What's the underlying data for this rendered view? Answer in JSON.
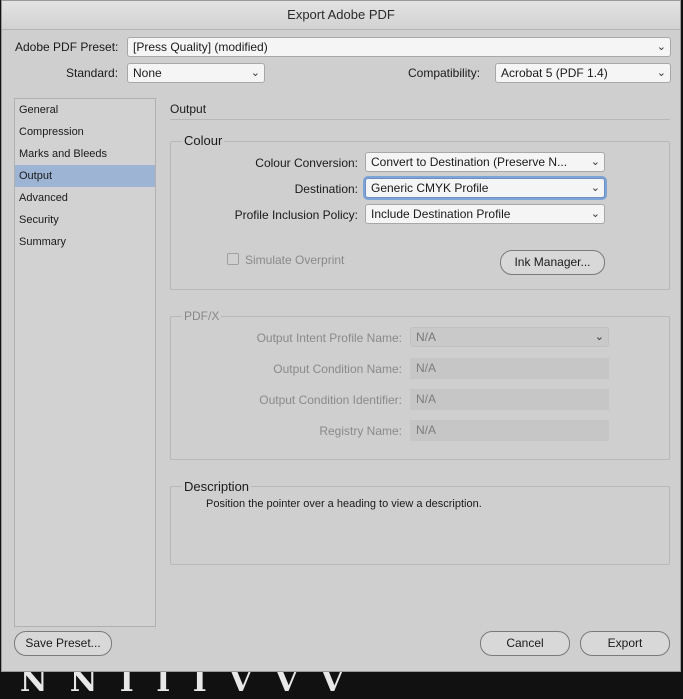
{
  "window_title": "Export Adobe PDF",
  "preset": {
    "label": "Adobe PDF Preset:",
    "value": "[Press Quality] (modified)"
  },
  "standard": {
    "label": "Standard:",
    "value": "None"
  },
  "compatibility": {
    "label": "Compatibility:",
    "value": "Acrobat 5 (PDF 1.4)"
  },
  "sidebar": {
    "items": [
      {
        "label": "General"
      },
      {
        "label": "Compression"
      },
      {
        "label": "Marks and Bleeds"
      },
      {
        "label": "Output"
      },
      {
        "label": "Advanced"
      },
      {
        "label": "Security"
      },
      {
        "label": "Summary"
      }
    ],
    "selected": "Output"
  },
  "panel_title": "Output",
  "colour": {
    "title": "Colour",
    "conversion_label": "Colour Conversion:",
    "conversion_value": "Convert to Destination (Preserve N...",
    "destination_label": "Destination:",
    "destination_value": "Generic CMYK Profile",
    "policy_label": "Profile Inclusion Policy:",
    "policy_value": "Include Destination Profile",
    "simulate_label": "Simulate Overprint",
    "ink_manager_label": "Ink Manager..."
  },
  "pdfx": {
    "title": "PDF/X",
    "intent_label": "Output Intent Profile Name:",
    "intent_value": "N/A",
    "condition_name_label": "Output Condition Name:",
    "condition_name_value": "N/A",
    "condition_id_label": "Output Condition Identifier:",
    "condition_id_value": "N/A",
    "registry_label": "Registry Name:",
    "registry_value": "N/A"
  },
  "description": {
    "title": "Description",
    "text": "Position the pointer over a heading to view a description."
  },
  "buttons": {
    "save_preset": "Save Preset...",
    "cancel": "Cancel",
    "export": "Export"
  }
}
